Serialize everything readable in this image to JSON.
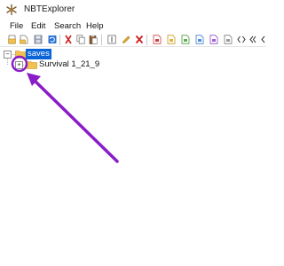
{
  "window": {
    "title": "NBTExplorer",
    "app_icon": "nbtexplorer-logo-icon"
  },
  "menu": {
    "items": [
      {
        "label": "File"
      },
      {
        "label": "Edit"
      },
      {
        "label": "Search"
      },
      {
        "label": "Help"
      }
    ]
  },
  "toolbar": {
    "buttons": [
      "open-folder-icon",
      "open-file-icon",
      "save-icon",
      "refresh-icon",
      "cut-icon",
      "copy-icon",
      "paste-icon",
      "rename-icon",
      "edit-icon",
      "delete-icon",
      "add-byte-tag-icon",
      "add-short-tag-icon",
      "add-int-tag-icon",
      "add-long-tag-icon",
      "add-float-tag-icon",
      "add-double-tag-icon",
      "add-byte-array-tag-icon",
      "add-int-array-tag-icon",
      "add-string-tag-icon",
      "add-list-tag-icon",
      "add-compound-tag-icon",
      "find-icon"
    ]
  },
  "tree": {
    "root": {
      "label": "saves",
      "expanded": true,
      "selected": true,
      "expander_glyph": "−"
    },
    "children": [
      {
        "label": "Survival 1_21_9",
        "expanded": false,
        "expander_glyph": "+"
      }
    ]
  },
  "annotation": {
    "color": "#8a1cc8"
  },
  "colors": {
    "selection": "#0a64d8",
    "folder": "#f2c14e",
    "accent_red": "#cc1f1f",
    "accent_blue": "#1f6fd1"
  }
}
